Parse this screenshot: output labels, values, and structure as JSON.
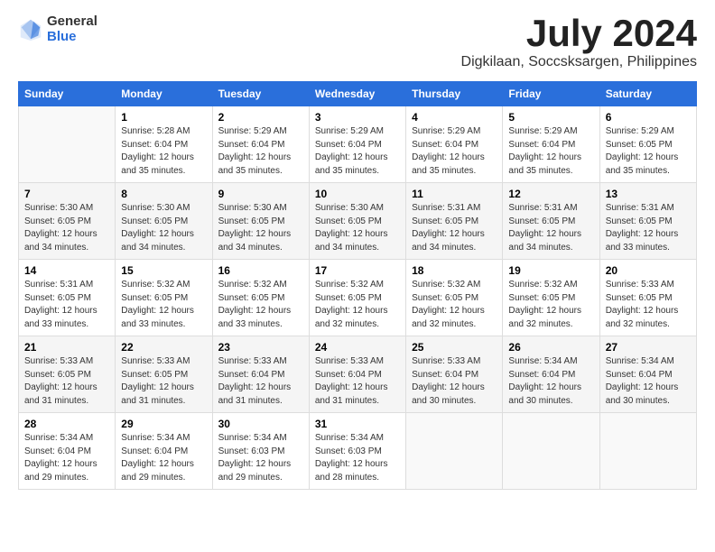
{
  "header": {
    "logo_general": "General",
    "logo_blue": "Blue",
    "month": "July 2024",
    "location": "Digkilaan, Soccsksargen, Philippines"
  },
  "columns": [
    "Sunday",
    "Monday",
    "Tuesday",
    "Wednesday",
    "Thursday",
    "Friday",
    "Saturday"
  ],
  "weeks": [
    [
      {
        "day": "",
        "info": ""
      },
      {
        "day": "1",
        "info": "Sunrise: 5:28 AM\nSunset: 6:04 PM\nDaylight: 12 hours\nand 35 minutes."
      },
      {
        "day": "2",
        "info": "Sunrise: 5:29 AM\nSunset: 6:04 PM\nDaylight: 12 hours\nand 35 minutes."
      },
      {
        "day": "3",
        "info": "Sunrise: 5:29 AM\nSunset: 6:04 PM\nDaylight: 12 hours\nand 35 minutes."
      },
      {
        "day": "4",
        "info": "Sunrise: 5:29 AM\nSunset: 6:04 PM\nDaylight: 12 hours\nand 35 minutes."
      },
      {
        "day": "5",
        "info": "Sunrise: 5:29 AM\nSunset: 6:04 PM\nDaylight: 12 hours\nand 35 minutes."
      },
      {
        "day": "6",
        "info": "Sunrise: 5:29 AM\nSunset: 6:05 PM\nDaylight: 12 hours\nand 35 minutes."
      }
    ],
    [
      {
        "day": "7",
        "info": "Sunrise: 5:30 AM\nSunset: 6:05 PM\nDaylight: 12 hours\nand 34 minutes."
      },
      {
        "day": "8",
        "info": "Sunrise: 5:30 AM\nSunset: 6:05 PM\nDaylight: 12 hours\nand 34 minutes."
      },
      {
        "day": "9",
        "info": "Sunrise: 5:30 AM\nSunset: 6:05 PM\nDaylight: 12 hours\nand 34 minutes."
      },
      {
        "day": "10",
        "info": "Sunrise: 5:30 AM\nSunset: 6:05 PM\nDaylight: 12 hours\nand 34 minutes."
      },
      {
        "day": "11",
        "info": "Sunrise: 5:31 AM\nSunset: 6:05 PM\nDaylight: 12 hours\nand 34 minutes."
      },
      {
        "day": "12",
        "info": "Sunrise: 5:31 AM\nSunset: 6:05 PM\nDaylight: 12 hours\nand 34 minutes."
      },
      {
        "day": "13",
        "info": "Sunrise: 5:31 AM\nSunset: 6:05 PM\nDaylight: 12 hours\nand 33 minutes."
      }
    ],
    [
      {
        "day": "14",
        "info": "Sunrise: 5:31 AM\nSunset: 6:05 PM\nDaylight: 12 hours\nand 33 minutes."
      },
      {
        "day": "15",
        "info": "Sunrise: 5:32 AM\nSunset: 6:05 PM\nDaylight: 12 hours\nand 33 minutes."
      },
      {
        "day": "16",
        "info": "Sunrise: 5:32 AM\nSunset: 6:05 PM\nDaylight: 12 hours\nand 33 minutes."
      },
      {
        "day": "17",
        "info": "Sunrise: 5:32 AM\nSunset: 6:05 PM\nDaylight: 12 hours\nand 32 minutes."
      },
      {
        "day": "18",
        "info": "Sunrise: 5:32 AM\nSunset: 6:05 PM\nDaylight: 12 hours\nand 32 minutes."
      },
      {
        "day": "19",
        "info": "Sunrise: 5:32 AM\nSunset: 6:05 PM\nDaylight: 12 hours\nand 32 minutes."
      },
      {
        "day": "20",
        "info": "Sunrise: 5:33 AM\nSunset: 6:05 PM\nDaylight: 12 hours\nand 32 minutes."
      }
    ],
    [
      {
        "day": "21",
        "info": "Sunrise: 5:33 AM\nSunset: 6:05 PM\nDaylight: 12 hours\nand 31 minutes."
      },
      {
        "day": "22",
        "info": "Sunrise: 5:33 AM\nSunset: 6:05 PM\nDaylight: 12 hours\nand 31 minutes."
      },
      {
        "day": "23",
        "info": "Sunrise: 5:33 AM\nSunset: 6:04 PM\nDaylight: 12 hours\nand 31 minutes."
      },
      {
        "day": "24",
        "info": "Sunrise: 5:33 AM\nSunset: 6:04 PM\nDaylight: 12 hours\nand 31 minutes."
      },
      {
        "day": "25",
        "info": "Sunrise: 5:33 AM\nSunset: 6:04 PM\nDaylight: 12 hours\nand 30 minutes."
      },
      {
        "day": "26",
        "info": "Sunrise: 5:34 AM\nSunset: 6:04 PM\nDaylight: 12 hours\nand 30 minutes."
      },
      {
        "day": "27",
        "info": "Sunrise: 5:34 AM\nSunset: 6:04 PM\nDaylight: 12 hours\nand 30 minutes."
      }
    ],
    [
      {
        "day": "28",
        "info": "Sunrise: 5:34 AM\nSunset: 6:04 PM\nDaylight: 12 hours\nand 29 minutes."
      },
      {
        "day": "29",
        "info": "Sunrise: 5:34 AM\nSunset: 6:04 PM\nDaylight: 12 hours\nand 29 minutes."
      },
      {
        "day": "30",
        "info": "Sunrise: 5:34 AM\nSunset: 6:03 PM\nDaylight: 12 hours\nand 29 minutes."
      },
      {
        "day": "31",
        "info": "Sunrise: 5:34 AM\nSunset: 6:03 PM\nDaylight: 12 hours\nand 28 minutes."
      },
      {
        "day": "",
        "info": ""
      },
      {
        "day": "",
        "info": ""
      },
      {
        "day": "",
        "info": ""
      }
    ]
  ]
}
